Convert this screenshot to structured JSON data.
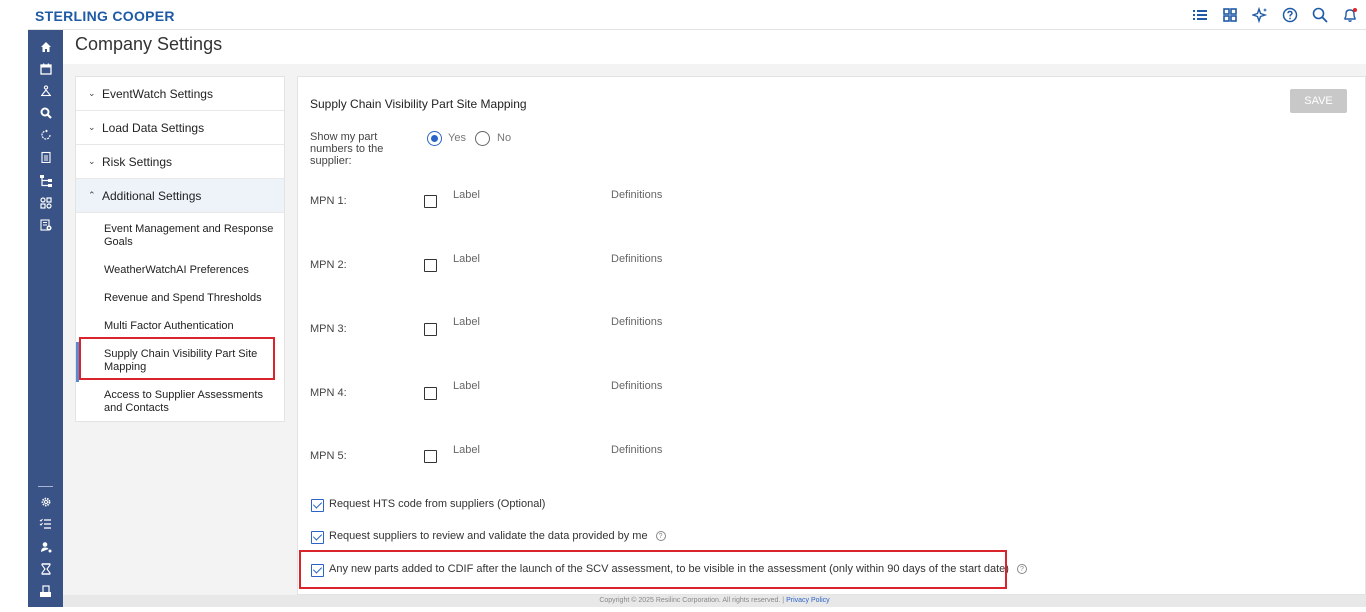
{
  "brand": "STERLING COOPER",
  "top_icons": [
    "list-icon",
    "grid-icon",
    "sparkle-icon",
    "help-icon",
    "search-icon",
    "bell-icon"
  ],
  "page_title": "Company Settings",
  "nav": {
    "sections": [
      {
        "label": "EventWatch Settings",
        "expanded": false
      },
      {
        "label": "Load Data Settings",
        "expanded": false
      },
      {
        "label": "Risk Settings",
        "expanded": false
      },
      {
        "label": "Additional Settings",
        "expanded": true
      }
    ],
    "sub_items": [
      "Event Management and Response Goals",
      "WeatherWatchAI Preferences",
      "Revenue and Spend Thresholds",
      "Multi Factor Authentication",
      "Supply Chain Visibility Part Site Mapping",
      "Access to Supplier Assessments and Contacts"
    ],
    "selected_sub_item": "Supply Chain Visibility Part Site Mapping"
  },
  "main": {
    "title": "Supply Chain Visibility Part Site Mapping",
    "save_label": "SAVE",
    "show_parts_label": "Show my part numbers to the supplier:",
    "yes_label": "Yes",
    "no_label": "No",
    "show_parts_value": "Yes",
    "mpns": [
      {
        "label": "MPN 1:",
        "field": "Label",
        "definitions": "Definitions",
        "checked": false
      },
      {
        "label": "MPN 2:",
        "field": "Label",
        "definitions": "Definitions",
        "checked": false
      },
      {
        "label": "MPN 3:",
        "field": "Label",
        "definitions": "Definitions",
        "checked": false
      },
      {
        "label": "MPN 4:",
        "field": "Label",
        "definitions": "Definitions",
        "checked": false
      },
      {
        "label": "MPN 5:",
        "field": "Label",
        "definitions": "Definitions",
        "checked": false
      }
    ],
    "options": [
      {
        "label": "Request HTS code from suppliers (Optional)",
        "checked": true,
        "help": false
      },
      {
        "label": "Request suppliers to review and validate the data provided by me",
        "checked": true,
        "help": true
      },
      {
        "label": "Any new parts added to CDIF after the launch of the SCV assessment, to be visible in the assessment (only within 90 days of the start date)",
        "checked": true,
        "help": true
      }
    ]
  },
  "footer": {
    "copyright": "Copyright © 2025 Resilinc Corporation. All rights reserved. |",
    "privacy": "Privacy Policy"
  },
  "colors": {
    "brand": "#1f5aa6",
    "sidebar": "#3a5387",
    "highlight": "#d9232d",
    "accent": "#2b64c6"
  }
}
